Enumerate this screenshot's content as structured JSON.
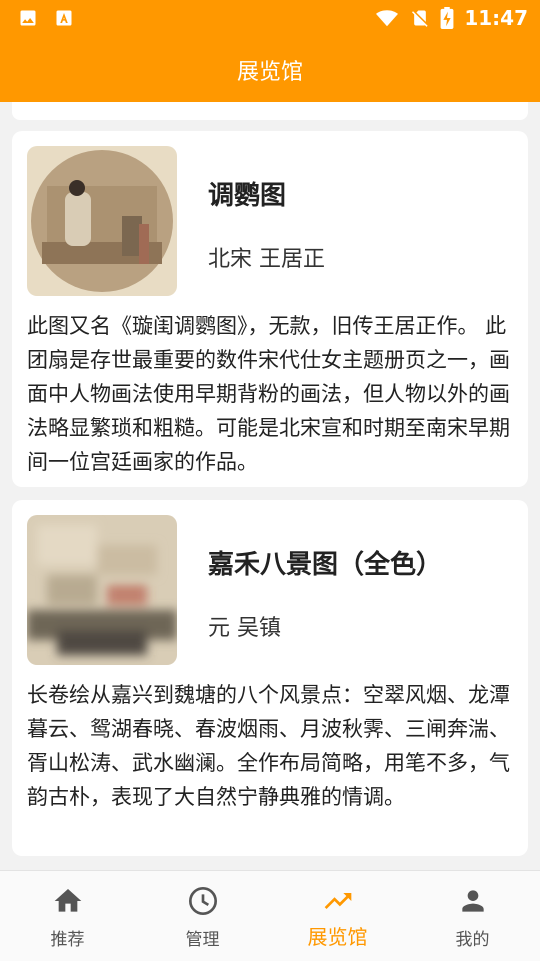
{
  "status_bar": {
    "time": "11:47",
    "icons": [
      "image-icon",
      "a-box-icon",
      "wifi-icon",
      "no-sim-icon",
      "battery-charging-icon"
    ]
  },
  "app_bar": {
    "title": "展览馆"
  },
  "exhibits": [
    {
      "name": "调鹦图",
      "author": "北宋 王居正",
      "description": "此图又名《璇闺调鹦图》，无款，旧传王居正作。 此团扇是存世最重要的数件宋代仕女主题册页之一，画面中人物画法使用早期背粉的画法，但人物以外的画法略显繁琐和粗糙。可能是北宋宣和时期至南宋早期间一位宫廷画家的作品。"
    },
    {
      "name": "嘉禾八景图（全色）",
      "author": "元 吴镇",
      "description": "长卷绘从嘉兴到魏塘的八个风景点：空翠风烟、龙潭暮云、鸳湖春晓、春波烟雨、月波秋霁、三闸奔湍、胥山松涛、武水幽澜。全作布局简略，用笔不多，气韵古朴，表现了大自然宁静典雅的情调。"
    }
  ],
  "bottom_nav": {
    "items": [
      {
        "label": "推荐",
        "icon": "home-icon"
      },
      {
        "label": "管理",
        "icon": "clock-icon"
      },
      {
        "label": "展览馆",
        "icon": "trending-up-icon"
      },
      {
        "label": "我的",
        "icon": "person-icon"
      }
    ],
    "active_index": 2
  },
  "colors": {
    "accent": "#ff9800",
    "background": "#f2f2f2",
    "card": "#ffffff"
  }
}
